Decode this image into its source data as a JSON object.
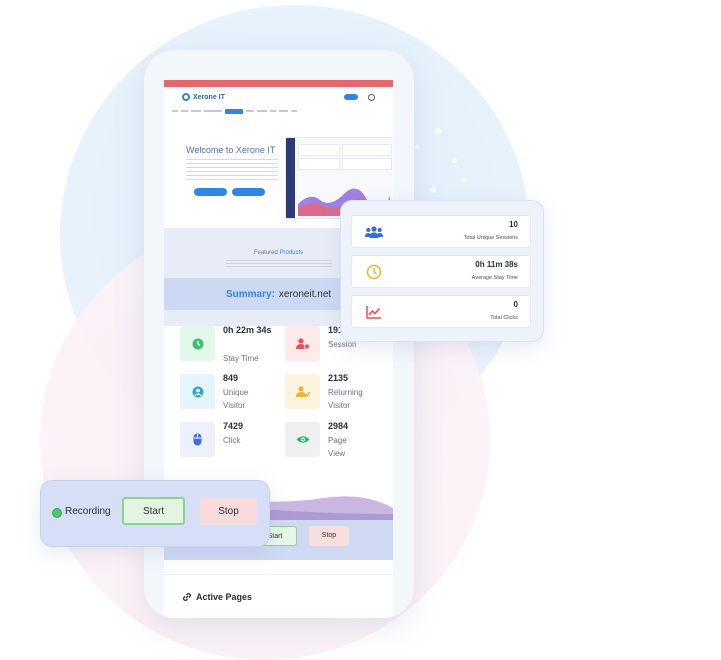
{
  "colors": {
    "accent": "#2f86e6",
    "recording": "#4fc86b",
    "stop_bg": "#f8dcdc",
    "start_bg": "#e3f5e1"
  },
  "site": {
    "logo": "Xerone IT",
    "hero_title": "Welcome to Xerone IT",
    "featured_title": "Featured",
    "featured_title_accent": "Products"
  },
  "summary": {
    "label": "Summary:",
    "domain": "xeroneit.net"
  },
  "stats": [
    {
      "value": "0h 22m 34s",
      "label": "Stay Time",
      "icon": "clock-icon"
    },
    {
      "value": "191",
      "label": "Session",
      "icon": "user-session-icon"
    },
    {
      "value": "849",
      "label": "Unique Visitor",
      "icon": "user-circle-icon"
    },
    {
      "value": "2135",
      "label": "Returning Visitor",
      "icon": "returning-user-icon"
    },
    {
      "value": "7429",
      "label": "Click",
      "icon": "mouse-icon"
    },
    {
      "value": "2984",
      "label": "Page View",
      "icon": "eye-icon"
    }
  ],
  "metrics": [
    {
      "value": "10",
      "label": "Total Unique Sessions",
      "icon": "users-icon"
    },
    {
      "value": "0h 11m 38s",
      "label": "Average Stay Time",
      "icon": "clock-icon"
    },
    {
      "value": "0",
      "label": "Total Clicks",
      "icon": "chart-line-icon"
    }
  ],
  "recording": {
    "label": "Recording",
    "start": "Start",
    "stop": "Stop"
  },
  "mini_controls": {
    "start": "Start",
    "stop": "Stop"
  },
  "active_pages": {
    "title": "Active Pages"
  }
}
